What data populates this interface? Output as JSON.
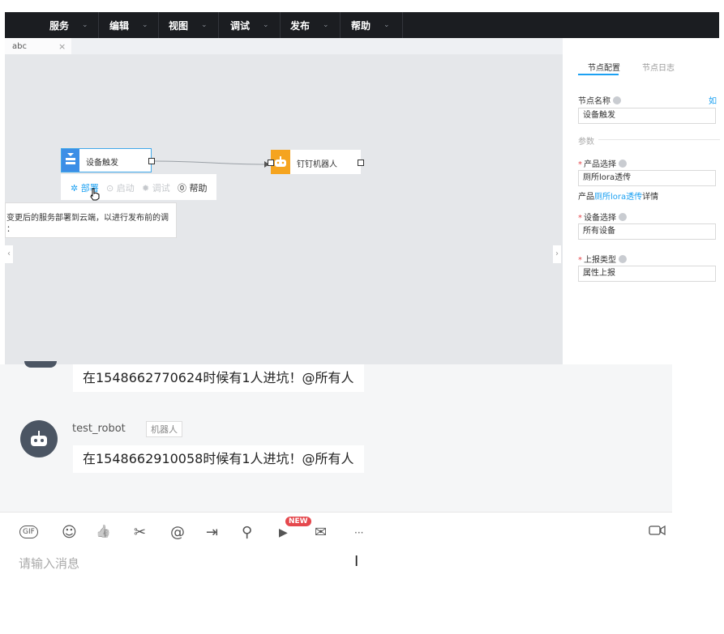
{
  "menubar": {
    "items": [
      {
        "label": "服务"
      },
      {
        "label": "编辑"
      },
      {
        "label": "视图"
      },
      {
        "label": "调试"
      },
      {
        "label": "发布"
      },
      {
        "label": "帮助"
      }
    ],
    "chevron": "⌄"
  },
  "tabs": [
    {
      "label": "abc",
      "close": "×"
    }
  ],
  "flow": {
    "nodes": [
      {
        "label": "设备触发",
        "icon": "device-trigger-icon"
      },
      {
        "label": "钉钉机器人",
        "icon": "robot-icon"
      }
    ],
    "actions": [
      {
        "label": "部署",
        "icon": "deploy-icon",
        "state": "active"
      },
      {
        "label": "启动",
        "icon": "start-icon",
        "state": "disabled"
      },
      {
        "label": "调试",
        "icon": "debug-icon",
        "state": "disabled"
      },
      {
        "label": "帮助",
        "icon": "help-icon",
        "state": "normal"
      }
    ],
    "tooltip": "变更后的服务部署到云端，以进行发布前的调",
    "tooltip_line2": "：",
    "left_handle": "‹",
    "right_handle": "›"
  },
  "panel": {
    "tabs": [
      {
        "label": "节点配置",
        "active": true
      },
      {
        "label": "节点日志",
        "active": false
      }
    ],
    "node_name_label": "节点名称",
    "node_name_link": "如",
    "node_name_value": "设备触发",
    "section_params": "参数",
    "product_label": "产品选择",
    "product_value": "厕所lora透传",
    "product_detail_prefix": "产品",
    "product_detail_link": "厕所lora透传",
    "product_detail_suffix": "详情",
    "device_label": "设备选择",
    "device_value": "所有设备",
    "report_label": "上报类型",
    "report_value": "属性上报",
    "required_mark": "*"
  },
  "chat": {
    "messages": [
      {
        "text": "在1548662770624时候有1人进坑！@所有人"
      },
      {
        "sender": "test_robot",
        "tag": "机器人",
        "text": "在1548662910058时候有1人进坑！@所有人"
      }
    ]
  },
  "composer": {
    "toolbar": [
      {
        "icon": "gif-icon",
        "glyph": "GIF"
      },
      {
        "icon": "emoji-icon",
        "glyph": "☺"
      },
      {
        "icon": "thumbs-up-icon",
        "glyph": "👍"
      },
      {
        "icon": "scissors-icon",
        "glyph": "✂"
      },
      {
        "icon": "at-icon",
        "glyph": "@"
      },
      {
        "icon": "forward-icon",
        "glyph": "⇥"
      },
      {
        "icon": "pin-icon",
        "glyph": "⚲"
      },
      {
        "icon": "video-message-icon",
        "glyph": "▶"
      },
      {
        "icon": "mail-icon",
        "glyph": "✉"
      },
      {
        "icon": "more-icon",
        "glyph": "···"
      }
    ],
    "new_badge": "NEW",
    "placeholder": "请输入消息",
    "video_call_icon": "video-call-icon"
  },
  "colors": {
    "accent": "#1da1f2",
    "menubar_bg": "#1b1d21",
    "canvas_bg": "#e5e7ea",
    "trigger_blue": "#3c8ee6",
    "robot_orange": "#f5a41f",
    "required_red": "#e5484d"
  }
}
